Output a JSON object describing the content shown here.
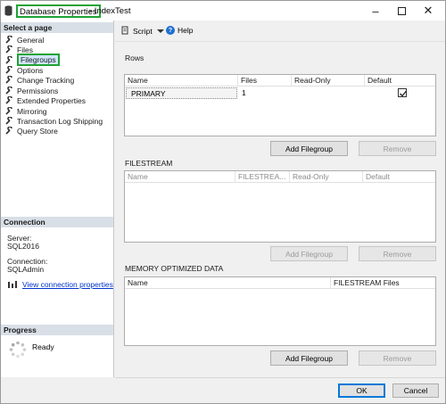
{
  "window": {
    "title_main": "Database Properties",
    "title_rest": "- IndexTest"
  },
  "left": {
    "select_page_header": "Select a page",
    "pages": [
      "General",
      "Files",
      "Filegroups",
      "Options",
      "Change Tracking",
      "Permissions",
      "Extended Properties",
      "Mirroring",
      "Transaction Log Shipping",
      "Query Store"
    ],
    "selected_page": "Filegroups",
    "connection_header": "Connection",
    "server_label": "Server:",
    "server_value": "SQL2016",
    "connection_label": "Connection:",
    "connection_value": "SQLAdmin",
    "view_connection_link": "View connection properties",
    "progress_header": "Progress",
    "progress_status": "Ready"
  },
  "toolbar": {
    "script_label": "Script",
    "help_label": "Help"
  },
  "rows_section": {
    "label": "Rows",
    "columns": [
      "Name",
      "Files",
      "Read-Only",
      "Default"
    ],
    "rows": [
      {
        "name": "PRIMARY",
        "files": "1",
        "read_only": false,
        "default": true
      }
    ],
    "add_button": "Add Filegroup",
    "remove_button": "Remove"
  },
  "filestream_section": {
    "label": "FILESTREAM",
    "columns": [
      "Name",
      "FILESTREA...",
      "Read-Only",
      "Default"
    ],
    "add_button": "Add Filegroup",
    "remove_button": "Remove"
  },
  "memory_section": {
    "label": "MEMORY OPTIMIZED DATA",
    "columns": [
      "Name",
      "FILESTREAM Files"
    ],
    "add_button": "Add Filegroup",
    "remove_button": "Remove"
  },
  "footer": {
    "ok_label": "OK",
    "cancel_label": "Cancel"
  }
}
